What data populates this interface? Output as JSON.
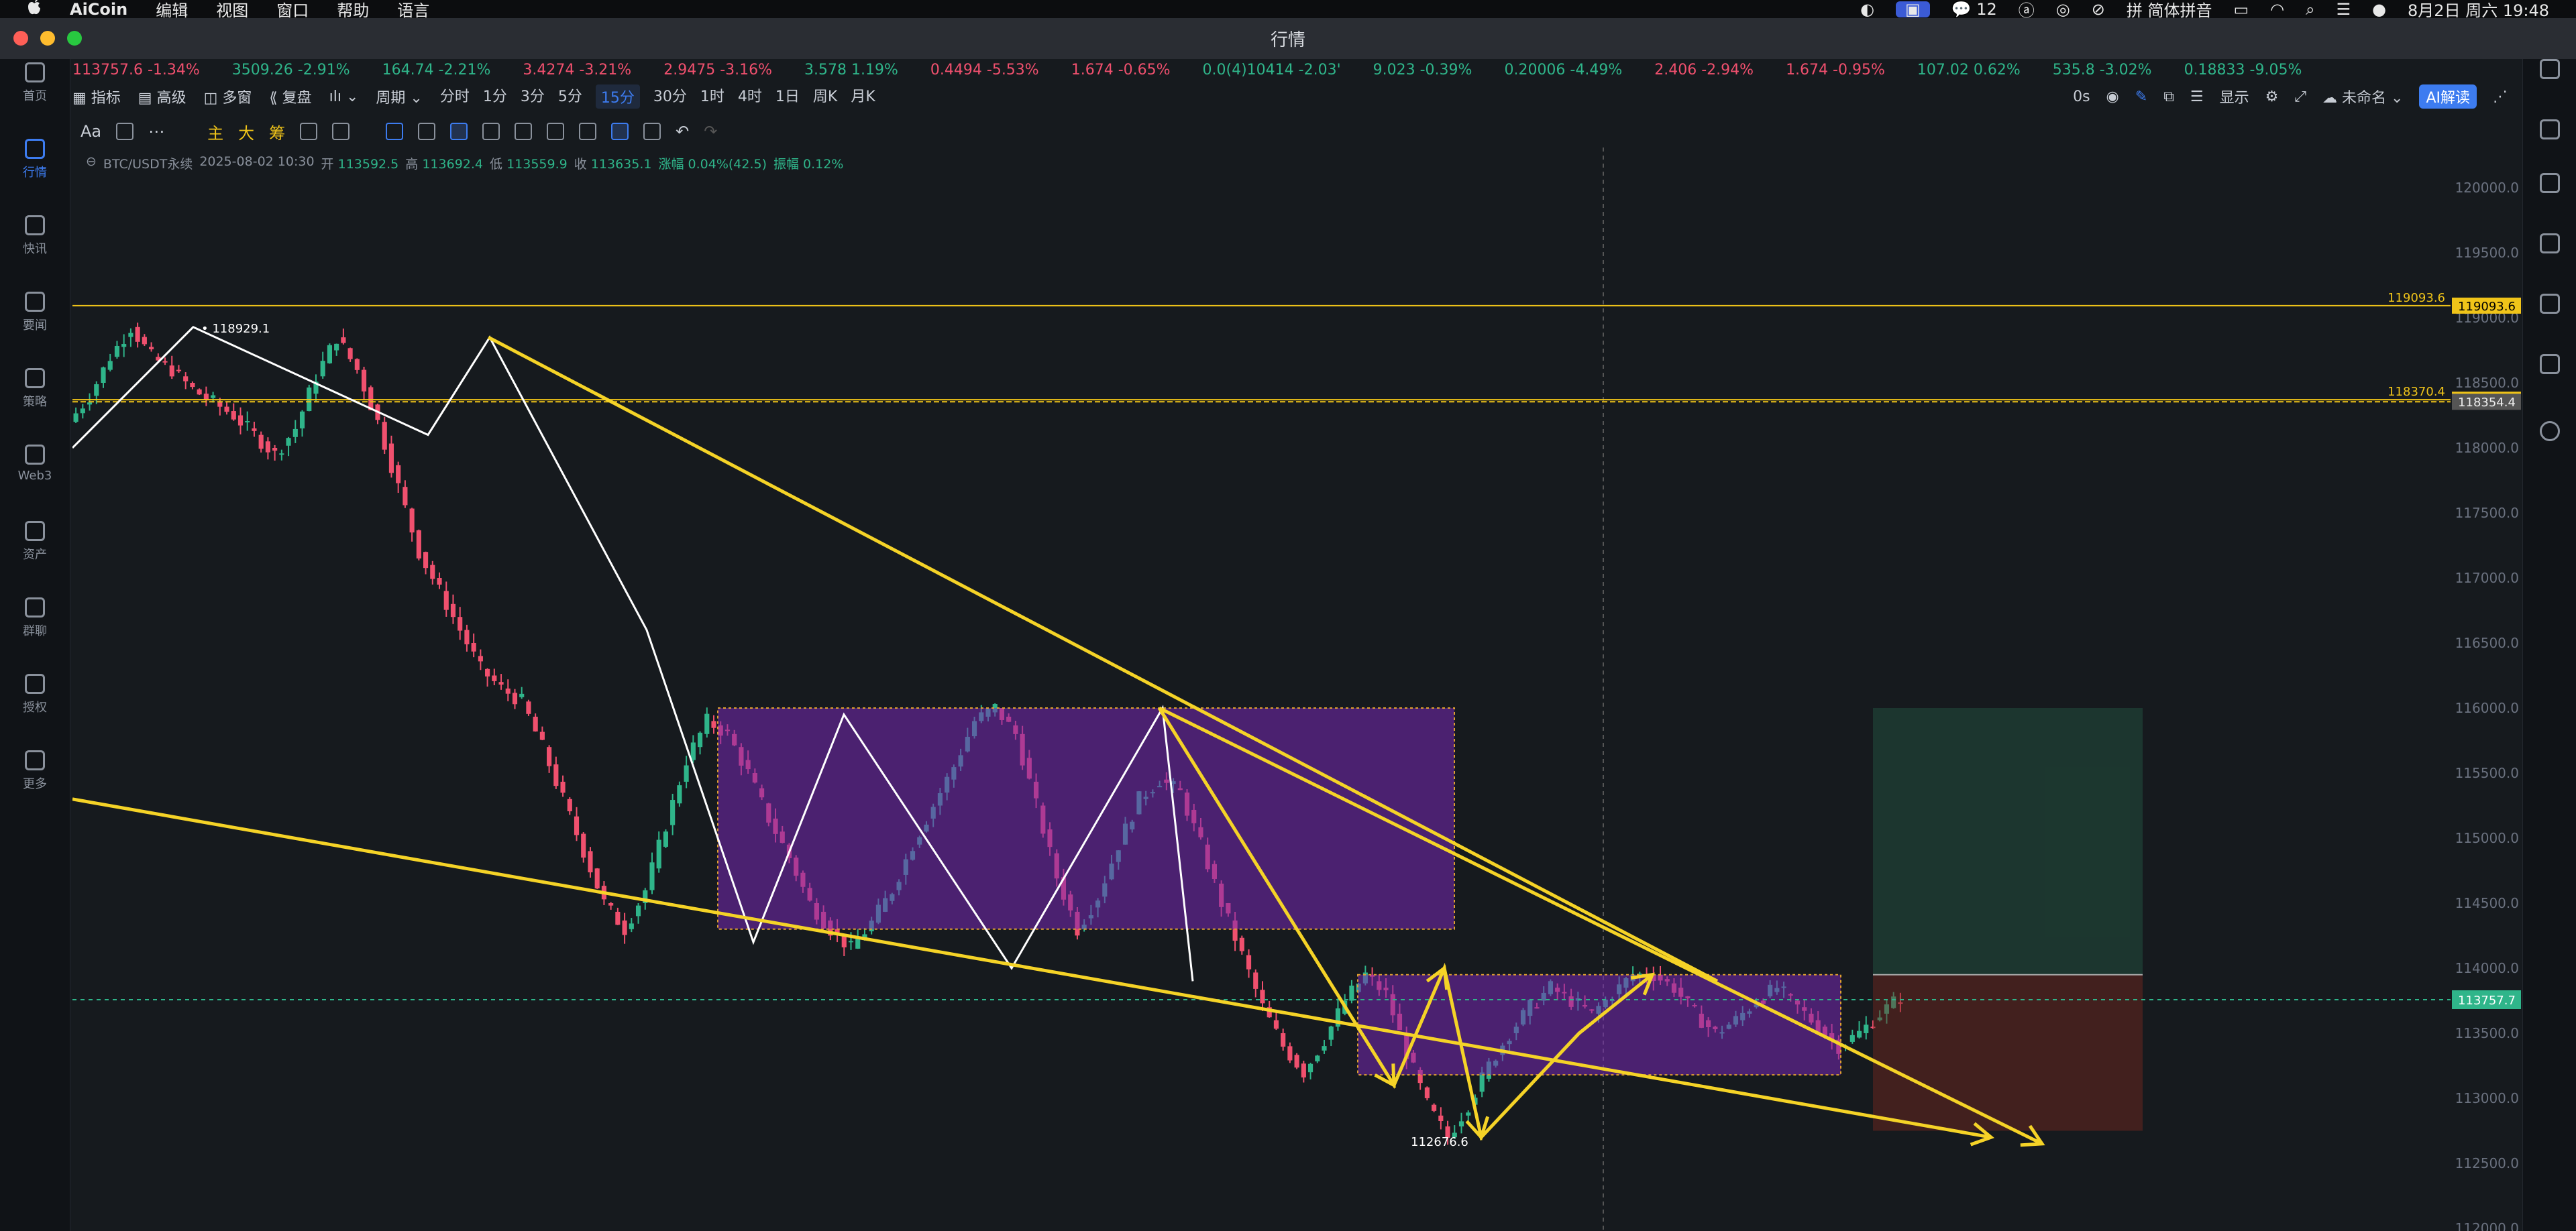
{
  "menubar": {
    "apple": "",
    "app": "AiCoin",
    "items": [
      "编辑",
      "视图",
      "窗口",
      "帮助",
      "语言"
    ],
    "ime": "简体拼音",
    "wechat_count": "12",
    "datetime": "8月2日 周六 19:48"
  },
  "window": {
    "title": "行情"
  },
  "sidebar": [
    {
      "label": "首页",
      "icon": "home-icon"
    },
    {
      "label": "行情",
      "icon": "chart-bar-icon",
      "active": true
    },
    {
      "label": "快讯",
      "icon": "news-icon"
    },
    {
      "label": "要闻",
      "icon": "document-icon"
    },
    {
      "label": "策略",
      "icon": "robot-icon"
    },
    {
      "label": "Web3",
      "icon": "web3-icon"
    },
    {
      "label": "资产",
      "icon": "wallet-icon"
    },
    {
      "label": "群聊",
      "icon": "chat-icon"
    },
    {
      "label": "授权",
      "icon": "key-icon"
    },
    {
      "label": "更多",
      "icon": "grid-icon"
    }
  ],
  "ticker": [
    {
      "text": "113757.6  -1.34%",
      "color": "#f0506e"
    },
    {
      "text": "3509.26  -2.91%",
      "color": "#2fb58a"
    },
    {
      "text": "164.74  -2.21%",
      "color": "#2fb58a"
    },
    {
      "text": "3.4274  -3.21%",
      "color": "#f0506e"
    },
    {
      "text": "2.9475  -3.16%",
      "color": "#f0506e"
    },
    {
      "text": "3.578  1.19%",
      "color": "#2fb58a"
    },
    {
      "text": "0.4494  -5.53%",
      "color": "#f0506e"
    },
    {
      "text": "1.674  -0.65%",
      "color": "#f0506e"
    },
    {
      "text": "0.0(4)10414  -2.03'",
      "color": "#2fb58a"
    },
    {
      "text": "9.023  -0.39%",
      "color": "#2fb58a"
    },
    {
      "text": "0.20006  -4.49%",
      "color": "#2fb58a"
    },
    {
      "text": "2.406  -2.94%",
      "color": "#f0506e"
    },
    {
      "text": "1.674  -0.95%",
      "color": "#f0506e"
    },
    {
      "text": "107.02  0.62%",
      "color": "#2fb58a"
    },
    {
      "text": "535.8  -3.02%",
      "color": "#2fb58a"
    },
    {
      "text": "0.18833  -9.05%",
      "color": "#2fb58a"
    }
  ],
  "toolbar": {
    "indicator": "指标",
    "advanced": "高级",
    "multi": "多窗",
    "replay": "复盘",
    "period": "周期",
    "intervals": [
      "分时",
      "1分",
      "3分",
      "5分",
      "15分",
      "30分",
      "1时",
      "4时",
      "1日",
      "周K",
      "月K"
    ],
    "selected_interval": "15分",
    "countdown": "0s",
    "display": "显示",
    "unnamed": "未命名",
    "ai": "AI解读"
  },
  "drawtools": {
    "text_tool": "Aa",
    "main": "主",
    "big": "大",
    "chip": "筹"
  },
  "info": {
    "symbol": "BTC/USDT永续",
    "time": "2025-08-02 10:30",
    "open_label": "开",
    "open": "113592.5",
    "high_label": "高",
    "high": "113692.4",
    "low_label": "低",
    "low": "113559.9",
    "close_label": "收",
    "close": "113635.1",
    "change": "涨幅 0.04%(42.5)",
    "amplitude": "振幅 0.12%"
  },
  "chart_data": {
    "type": "candlestick",
    "symbol": "BTC/USDT永续",
    "y_ticks": [
      112000,
      112500,
      113000,
      113500,
      114000,
      114500,
      115000,
      115500,
      116000,
      116500,
      117000,
      117500,
      118000,
      118500,
      119000,
      119500,
      120000
    ],
    "ylim": [
      112000,
      120000
    ],
    "price_lines": [
      {
        "value": 119093.6,
        "label": "119093.6",
        "color": "#f0c419"
      },
      {
        "value": 118370.4,
        "label": "118370.4",
        "color": "#f0c419"
      },
      {
        "value": 118354.4,
        "label": "118354.4",
        "color": "#f0c419",
        "dashed": true
      }
    ],
    "current_price": {
      "value": 113757.7,
      "label": "113757.7",
      "color": "#2fb58a"
    },
    "annotations": [
      {
        "text": "118929.1",
        "price": 118929.1
      },
      {
        "text": "112676.6",
        "price": 112676.6
      }
    ],
    "candle_path": [
      118200,
      118400,
      118700,
      118929,
      118700,
      118600,
      118450,
      118350,
      118250,
      118100,
      117950,
      118150,
      118550,
      118850,
      118600,
      118200,
      117700,
      117200,
      116900,
      116600,
      116300,
      116150,
      116050,
      115700,
      115300,
      114900,
      114500,
      114300,
      114600,
      115100,
      115600,
      115900,
      115800,
      115500,
      115150,
      114850,
      114500,
      114300,
      114150,
      114350,
      114600,
      114950,
      115250,
      115550,
      115900,
      116000,
      115800,
      115250,
      114700,
      114300,
      114550,
      114950,
      115300,
      115450,
      115350,
      114950,
      114500,
      114100,
      113700,
      113400,
      113200,
      113450,
      113750,
      113950,
      113800,
      113350,
      112950,
      112700,
      112950,
      113250,
      113500,
      113700,
      113850,
      113750,
      113650,
      113800,
      113950,
      113950,
      113850,
      113650,
      113500,
      113600,
      113750,
      113850,
      113700,
      113550,
      113400,
      113500,
      113650,
      113780
    ]
  }
}
